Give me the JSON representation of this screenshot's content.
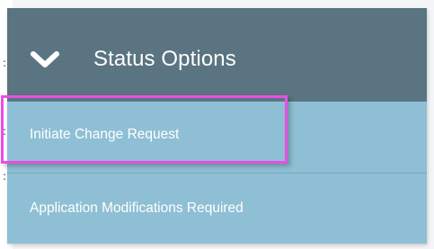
{
  "background_marks": [
    ":",
    ":",
    ":"
  ],
  "menu": {
    "header": {
      "icon": "chevron-down-icon",
      "title": "Status Options"
    },
    "items": [
      {
        "label": "Initiate Change Request",
        "highlighted": true
      },
      {
        "label": "Application Modifications Required",
        "highlighted": false
      }
    ]
  },
  "colors": {
    "header_bg": "#5a7481",
    "item_bg": "#8fbfd5",
    "highlight_border": "#e84fe3",
    "text": "#ffffff"
  }
}
